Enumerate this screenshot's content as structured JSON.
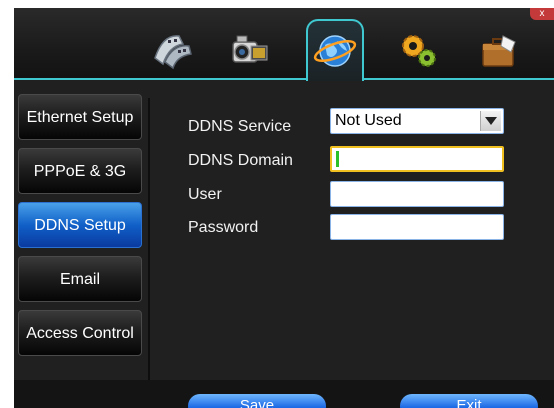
{
  "window": {
    "close_label": "x"
  },
  "toolbar": {
    "icons": [
      {
        "name": "film-icon"
      },
      {
        "name": "camcorder-icon"
      },
      {
        "name": "network-globe-icon"
      },
      {
        "name": "gears-icon"
      },
      {
        "name": "toolbox-icon"
      }
    ],
    "active_index": 2
  },
  "sidebar": {
    "items": [
      {
        "label": "Ethernet Setup"
      },
      {
        "label": "PPPoE & 3G"
      },
      {
        "label": "DDNS Setup"
      },
      {
        "label": "Email"
      },
      {
        "label": "Access Control"
      }
    ],
    "active_index": 2
  },
  "form": {
    "service_label": "DDNS Service",
    "service_value": "Not Used",
    "domain_label": "DDNS Domain",
    "domain_value": "",
    "user_label": "User",
    "user_value": "",
    "password_label": "Password",
    "password_value": ""
  },
  "buttons": {
    "save_label": "Save",
    "exit_label": "Exit"
  },
  "colors": {
    "accent": "#40c8d0",
    "active_tab": "#1060c8",
    "focus": "#f0c020"
  }
}
